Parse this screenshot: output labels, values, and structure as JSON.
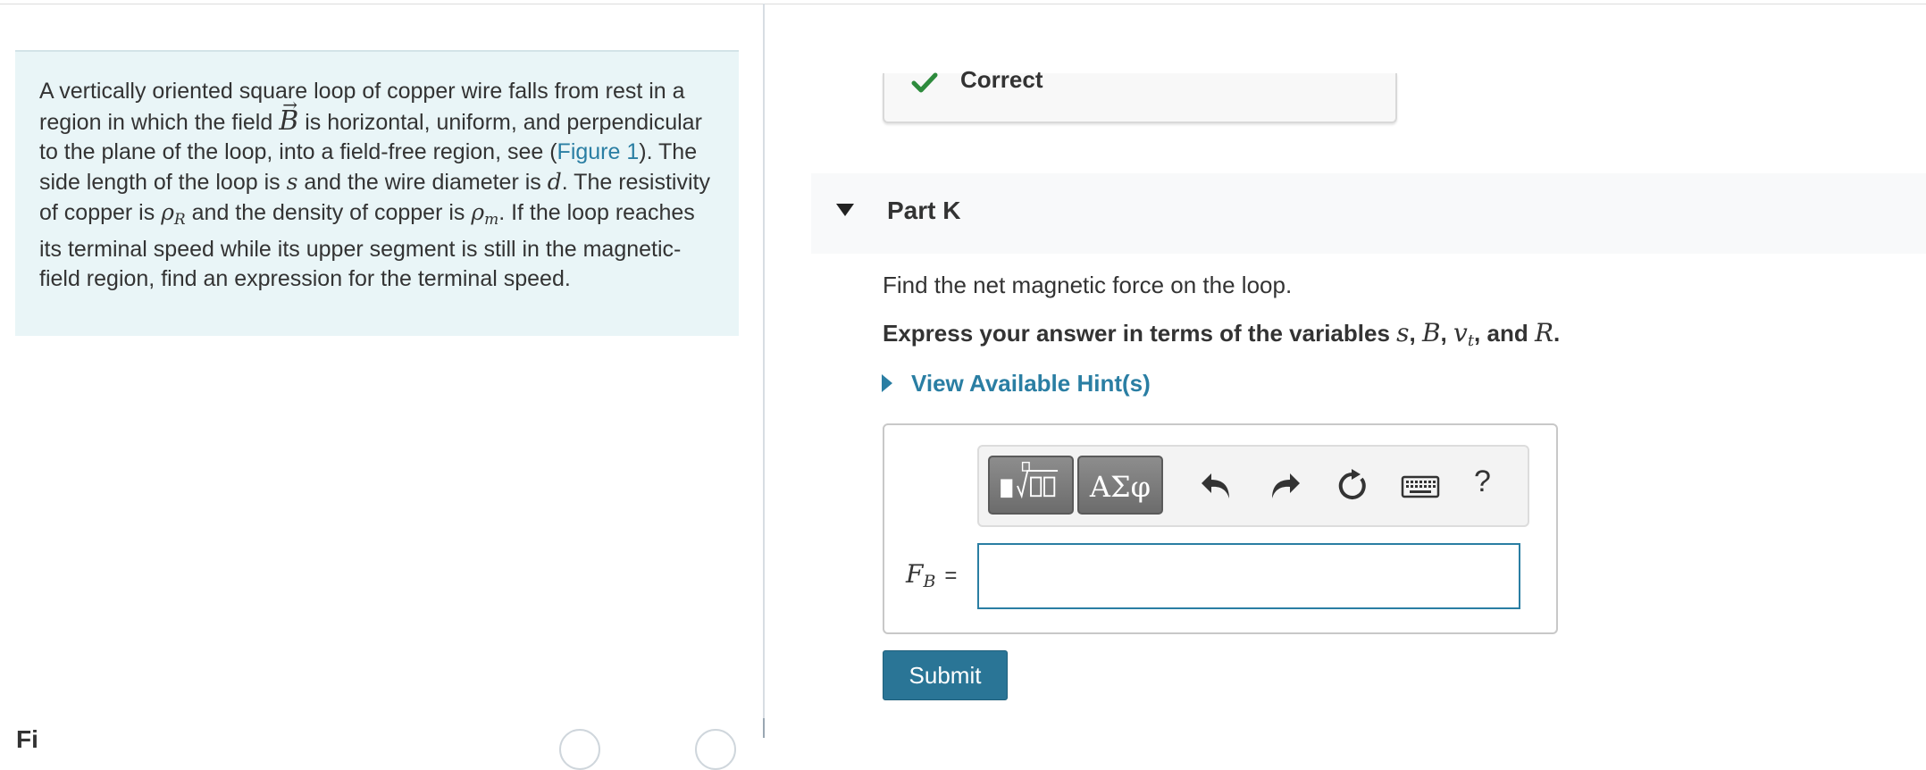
{
  "intro": {
    "t1": "A vertically oriented square loop of copper wire falls from rest in a region in which the field ",
    "b": "B",
    "t2": " is horizontal, uniform, and perpendicular to the plane of the loop, into a field-free region, see (",
    "figure_link": "Figure 1",
    "t3": "). The side length of the loop is ",
    "s": "s",
    "t4": " and the wire diameter is ",
    "d": "d",
    "t5": ". The resistivity of copper is ",
    "rho": "ρ",
    "rho_sub_r": "R",
    "t6": " and the density of copper is ",
    "rho_sub_m": "m",
    "t7": ". If the loop reaches its terminal speed while its upper segment is still in the magnetic-field region, find an expression for the terminal speed."
  },
  "figure": {
    "heading": "Fi"
  },
  "status": {
    "label": "Correct",
    "color": "#2e8b3d"
  },
  "part": {
    "title": "Part K",
    "question": "Find the net magnetic force on the loop.",
    "instruction_prefix": "Express your answer in terms of the variables ",
    "var_s": "s",
    "var_B": "B",
    "var_v": "v",
    "var_v_sub": "t",
    "var_R": "R",
    "sep": ", ",
    "and": ", and ",
    "period": "."
  },
  "hints": {
    "label": "View Available Hint(s)"
  },
  "toolbar": {
    "symbols_label": "ΑΣφ",
    "help_label": "?",
    "icons": [
      "templates-icon",
      "undo-icon",
      "redo-icon",
      "reset-icon",
      "keyboard-icon",
      "help-icon"
    ]
  },
  "answer": {
    "var": "F",
    "var_sub": "B",
    "equals": "=",
    "value": "",
    "placeholder": ""
  },
  "submit": {
    "label": "Submit"
  },
  "colors": {
    "accent": "#2a7ea3",
    "submit": "#2a7596",
    "intro_bg": "#e9f5f7",
    "check": "#2e8b3d"
  }
}
